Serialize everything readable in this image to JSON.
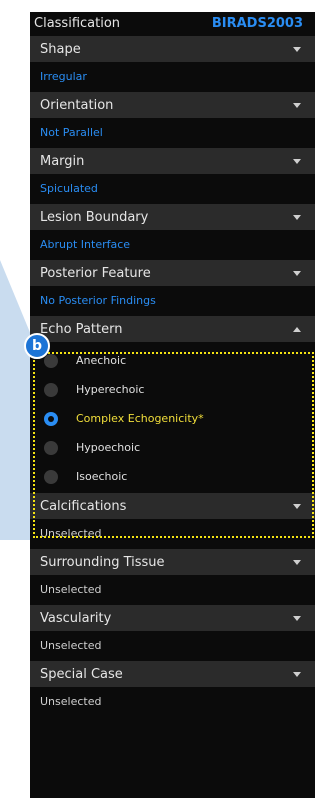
{
  "header": {
    "title": "Classification",
    "standard": "BIRADS2003"
  },
  "sections_before": [
    {
      "label": "Shape",
      "value": "Irregular"
    },
    {
      "label": "Orientation",
      "value": "Not Parallel"
    },
    {
      "label": "Margin",
      "value": "Spiculated"
    },
    {
      "label": "Lesion Boundary",
      "value": "Abrupt Interface"
    },
    {
      "label": "Posterior Feature",
      "value": "No Posterior Findings"
    }
  ],
  "echo_pattern": {
    "label": "Echo Pattern",
    "options": [
      {
        "label": "Anechoic",
        "selected": false
      },
      {
        "label": "Hyperechoic",
        "selected": false
      },
      {
        "label": "Complex Echogenicity*",
        "selected": true
      },
      {
        "label": "Hypoechoic",
        "selected": false
      },
      {
        "label": "Isoechoic",
        "selected": false
      }
    ]
  },
  "sections_after": [
    {
      "label": "Calcifications",
      "value": "Unselected"
    },
    {
      "label": "Surrounding Tissue",
      "value": "Unselected"
    },
    {
      "label": "Vascularity",
      "value": "Unselected"
    },
    {
      "label": "Special Case",
      "value": "Unselected"
    }
  ],
  "callout": {
    "badge": "b",
    "color": "#1c74d6",
    "highlight_color": "#f4e312"
  },
  "colors": {
    "accent": "#2a8df3",
    "selected_text": "#f2df3b",
    "panel_bg": "#0b0b0b",
    "header_bg": "#2b2b2b"
  },
  "icons": {
    "dropdown": "chevron-down-icon",
    "collapse": "chevron-up-icon",
    "radio": "radio-button-icon"
  }
}
